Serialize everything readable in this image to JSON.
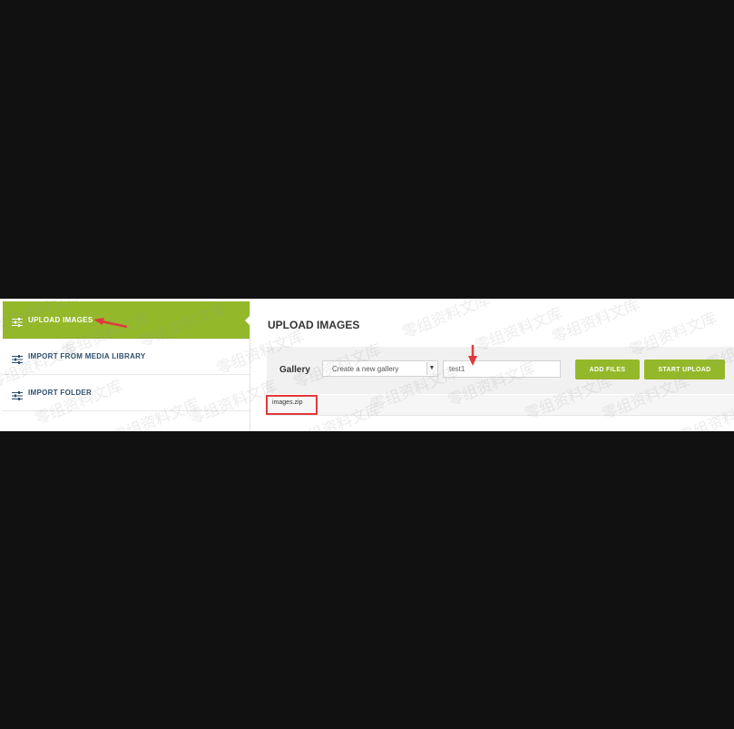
{
  "sidebar": {
    "items": [
      {
        "label": "UPLOAD IMAGES",
        "icon": "sliders-icon"
      },
      {
        "label": "IMPORT FROM MEDIA LIBRARY",
        "icon": "sliders-icon"
      },
      {
        "label": "IMPORT FOLDER",
        "icon": "sliders-icon"
      }
    ]
  },
  "main": {
    "title": "UPLOAD IMAGES",
    "gallery_label": "Gallery",
    "gallery_select_value": "Create a new gallery",
    "gallery_name_value": "test1",
    "add_files_label": "ADD FILES",
    "start_upload_label": "START UPLOAD",
    "file_name": "images.zip"
  },
  "watermark": "零组资料文库",
  "colors": {
    "accent": "#93b92a",
    "annotation_red": "#e0393e"
  }
}
